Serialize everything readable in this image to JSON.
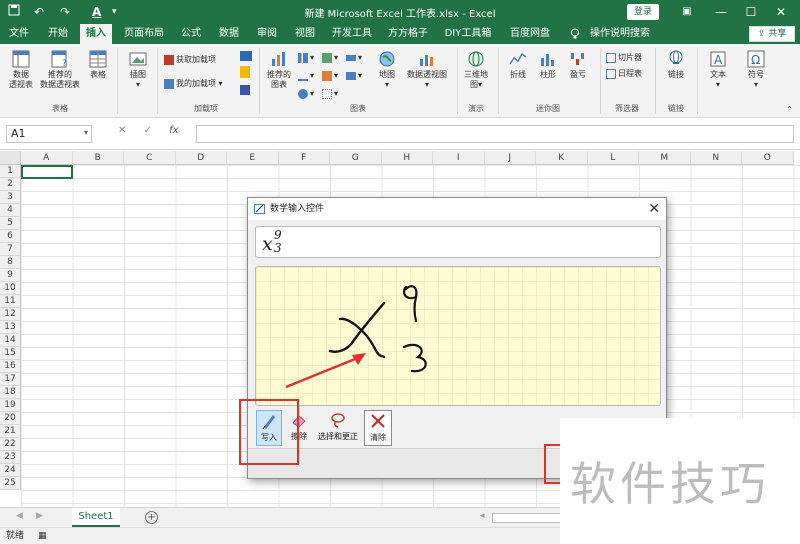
{
  "titlebar": {
    "title": "新建 Microsoft Excel 工作表.xlsx  -  Excel",
    "login": "登录",
    "save_icon": "save-icon",
    "undo_icon": "undo-icon",
    "redo_icon": "redo-icon",
    "format_icon": "font-format-icon",
    "minimize": "—",
    "maximize": "☐",
    "close": "✕"
  },
  "tabs": [
    "文件",
    "开始",
    "插入",
    "页面布局",
    "公式",
    "数据",
    "审阅",
    "视图",
    "开发工具",
    "方方格子",
    "DIY工具箱",
    "百度网盘",
    "操作说明搜索"
  ],
  "active_tab": "插入",
  "share": "共享",
  "ribbon": {
    "pivot": "数据\n透视表",
    "recommended_pivot": "推荐的\n数据透视表",
    "table": "表格",
    "group_tables": "表格",
    "illustrations": "插图",
    "get_addins": "获取加载项",
    "my_addins": "我的加载项",
    "group_addins": "加载项",
    "recommended_charts": "推荐的\n图表",
    "map": "地图",
    "pivot_chart": "数据透视图",
    "group_charts": "图表",
    "map3d": "三维地\n图",
    "group_tours": "演示",
    "line": "折线",
    "column": "柱形",
    "winloss": "盈亏",
    "group_sparklines": "迷你图",
    "slicer": "切片器",
    "timeline": "日程表",
    "group_filters": "筛选器",
    "link": "链接",
    "group_links": "链接",
    "text": "文本",
    "symbol": "符号"
  },
  "formula_bar": {
    "name_box": "A1",
    "cancel": "✕",
    "enter": "✓",
    "fx": "fx"
  },
  "columns": [
    "A",
    "B",
    "C",
    "D",
    "E",
    "F",
    "G",
    "H",
    "I",
    "J",
    "K",
    "L",
    "M",
    "N",
    "O"
  ],
  "rows": [
    "1",
    "2",
    "3",
    "4",
    "5",
    "6",
    "7",
    "8",
    "9",
    "10",
    "11",
    "12",
    "13",
    "14",
    "15",
    "16",
    "17",
    "18",
    "19",
    "20",
    "21",
    "22",
    "23",
    "24",
    "25"
  ],
  "sheet": {
    "tab": "Sheet1",
    "add": "+"
  },
  "status": "就绪",
  "dialog": {
    "title": "数学输入控件",
    "close": "✕",
    "preview_base": "x",
    "preview_sup": "9",
    "preview_sub": "3",
    "tools": [
      {
        "label": "写入",
        "icon": "pen-icon"
      },
      {
        "label": "擦除",
        "icon": "eraser-icon"
      },
      {
        "label": "选择和更正",
        "icon": "lasso-icon"
      },
      {
        "label": "清除",
        "icon": "clear-icon"
      }
    ]
  },
  "watermark": "软件技巧",
  "colors": {
    "excel_green": "#217346",
    "annotation_red": "#e03030",
    "canvas_yellow": "#fffbd3"
  }
}
